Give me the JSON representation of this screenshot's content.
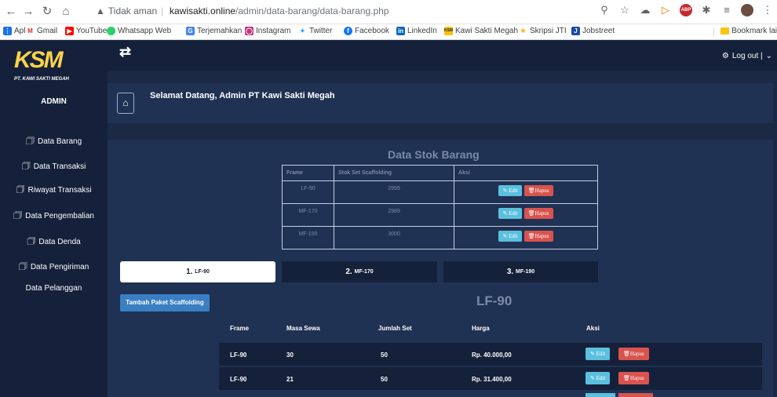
{
  "browser": {
    "security_label": "Tidak aman",
    "url_host": "kawisakti.online",
    "url_path": "/admin/data-barang/data-barang.php",
    "bookmarks": [
      {
        "label": "Apl",
        "icon": "apps-icon",
        "color": "#1a73e8"
      },
      {
        "label": "Gmail",
        "icon": "gmail-icon",
        "color": "#d93025"
      },
      {
        "label": "YouTube",
        "icon": "youtube-icon",
        "color": "#ff0000"
      },
      {
        "label": "Whatsapp Web",
        "icon": "whatsapp-icon",
        "color": "#25d366"
      },
      {
        "label": "Terjemahkan",
        "icon": "translate-icon",
        "color": "#4285f4"
      },
      {
        "label": "Instagram",
        "icon": "instagram-icon",
        "color": "#c13584"
      },
      {
        "label": "Twitter",
        "icon": "twitter-icon",
        "color": "#1da1f2"
      },
      {
        "label": "Facebook",
        "icon": "facebook-icon",
        "color": "#1877f2"
      },
      {
        "label": "LinkedIn",
        "icon": "linkedin-icon",
        "color": "#0a66c2"
      },
      {
        "label": "Kawi Sakti Megah",
        "icon": "ksm-icon",
        "color": "#ffc107"
      },
      {
        "label": "Skripsi JTI",
        "icon": "skripsi-icon",
        "color": "#f9ab00"
      },
      {
        "label": "Jobstreet",
        "icon": "jobstreet-icon",
        "color": "#1c4aa8"
      }
    ],
    "bookmark_other": "Bookmark lai"
  },
  "app": {
    "logo_text": "KSM",
    "logo_sub": "PT. KAWI SAKTI MEGAH",
    "role": "ADMIN",
    "logout_label": "Log out |",
    "welcome": "Selamat Datang, Admin PT Kawi Sakti Megah",
    "sidebar": [
      {
        "label": "Data Barang",
        "icon": true
      },
      {
        "label": "Data Transaksi",
        "icon": true
      },
      {
        "label": "Riwayat Transaksi",
        "icon": true
      },
      {
        "label": "Data Pengembalian",
        "icon": true
      },
      {
        "label": "Data Denda",
        "icon": true
      },
      {
        "label": "Data Pengiriman",
        "icon": true
      },
      {
        "label": "Data Pelanggan",
        "icon": false
      }
    ]
  },
  "stok": {
    "title": "Data Stok Barang",
    "headers": [
      "Frame",
      "Stok Set Scaffolding",
      "Aksi"
    ],
    "rows": [
      {
        "frame": "LF-90",
        "stok": "2999"
      },
      {
        "frame": "MF-170",
        "stok": "2989"
      },
      {
        "frame": "MF-190",
        "stok": "3000"
      }
    ],
    "edit_label": "Edit",
    "delete_label": "Hapus"
  },
  "tabs": [
    {
      "num": "1.",
      "label": "LF-90",
      "active": true
    },
    {
      "num": "2.",
      "label": "MF-170",
      "active": false
    },
    {
      "num": "3.",
      "label": "MF-190",
      "active": false
    }
  ],
  "paket": {
    "add_button": "Tambah Paket Scaffolding",
    "title": "LF-90",
    "headers": [
      "Frame",
      "Masa Sewa",
      "Jumlah Set",
      "Harga",
      "Aksi"
    ],
    "rows": [
      {
        "frame": "LF-90",
        "masa": "30",
        "jumlah": "50",
        "harga": "Rp. 40.000,00"
      },
      {
        "frame": "LF-90",
        "masa": "21",
        "jumlah": "50",
        "harga": "Rp. 31.400,00"
      }
    ]
  },
  "colors": {
    "sidebar_bg": "#15213a",
    "content_bg": "#1f3254",
    "edit_btn": "#5bc0de",
    "delete_btn": "#d9534f",
    "add_btn": "#3a7fc4"
  }
}
